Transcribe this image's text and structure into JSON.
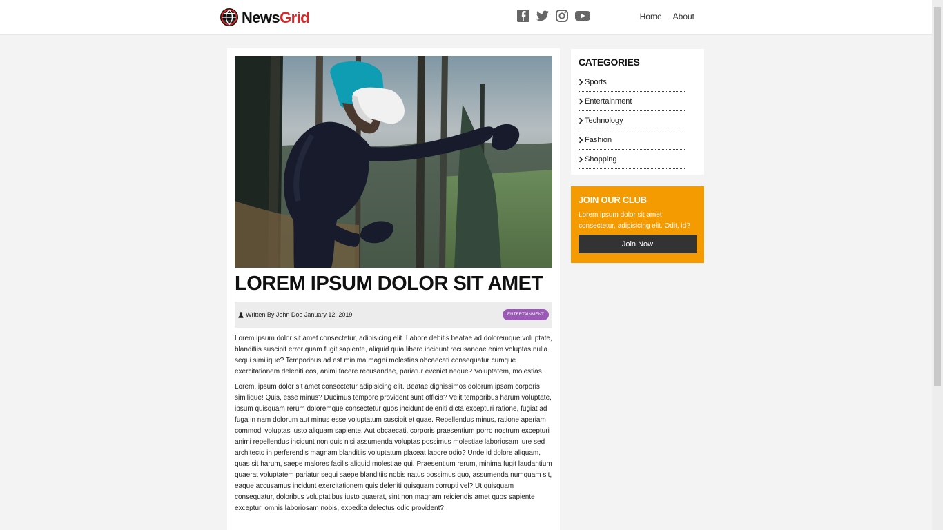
{
  "header": {
    "brand": {
      "part1": "News",
      "part2": "Grid",
      "logo_icon": "globe-icon",
      "accent_color": "#d62828"
    },
    "social_icons": [
      "facebook-icon",
      "twitter-icon",
      "instagram-icon",
      "youtube-icon"
    ],
    "nav": [
      {
        "label": "Home"
      },
      {
        "label": "About"
      }
    ]
  },
  "article": {
    "image_icon": "vr-headset-photo",
    "title": "Lorem Ipsum Dolor Sit Amet",
    "meta_icon": "user-icon",
    "meta_text": "Written By John Doe January 12, 2019",
    "category": "Entertainment",
    "category_color": "#9b59b6",
    "paragraphs": [
      "Lorem ipsum dolor sit amet consectetur, adipisicing elit. Labore debitis beatae ad doloremque voluptate, blanditiis suscipit error quam fugit sapiente, aliquid quia libero incidunt recusandae enim voluptas nulla sequi similique? Temporibus ad est minima magni molestias obcaecati consequatur cumque exercitationem deleniti eos, animi facere recusandae, pariatur eveniet neque? Voluptatem, molestias.",
      "Lorem, ipsum dolor sit amet consectetur adipisicing elit. Beatae dignissimos dolorum ipsam corporis similique! Quis, esse minus? Ducimus tempore provident sunt officia? Velit temporibus harum voluptate, ipsum quisquam rerum doloremque consectetur quos incidunt deleniti dicta excepturi ratione, fugiat ad fuga in nam dolorum aut minus esse voluptatum suscipit et quae. Repellendus minus, ratione aperiam commodi voluptas iusto aliquam sapiente. Aut obcaecati, corporis praesentium porro nostrum excepturi animi repellendus incidunt non quis nisi assumenda voluptas possimus molestiae laboriosam iure sed architecto in perferendis magnam blanditiis voluptatum placeat labore odio? Unde id dolore aliquam, quas sit harum, saepe malores facilis aliquid molestiae qui. Praesentium rerum, minima fugit laudantium quaerat voluptatem pariatur sequi saepe blanditiis nobis natus possimus quo, assumenda numquam sit, eaque accusamus incidunt exercitationem quis deleniti quisquam corrupti vel? Ut quisquam consequatur, doloribus voluptatibus iusto quaerat, sint non magnam reiciendis amet quos sapiente excepturi omnis laboriosam nobis, expedita delectus odio provident?"
    ]
  },
  "sidebar": {
    "categories": {
      "title": "Categories",
      "icon": "chevron-right-icon",
      "items": [
        {
          "label": "Sports"
        },
        {
          "label": "Entertainment"
        },
        {
          "label": "Technology"
        },
        {
          "label": "Fashion"
        },
        {
          "label": "Shopping"
        }
      ]
    },
    "club": {
      "title": "Join Our Club",
      "text": "Lorem ipsum dolor sit amet consectetur, adipisicing elit. Odit, id?",
      "button": "Join Now",
      "bg_color": "#f39b00"
    }
  }
}
